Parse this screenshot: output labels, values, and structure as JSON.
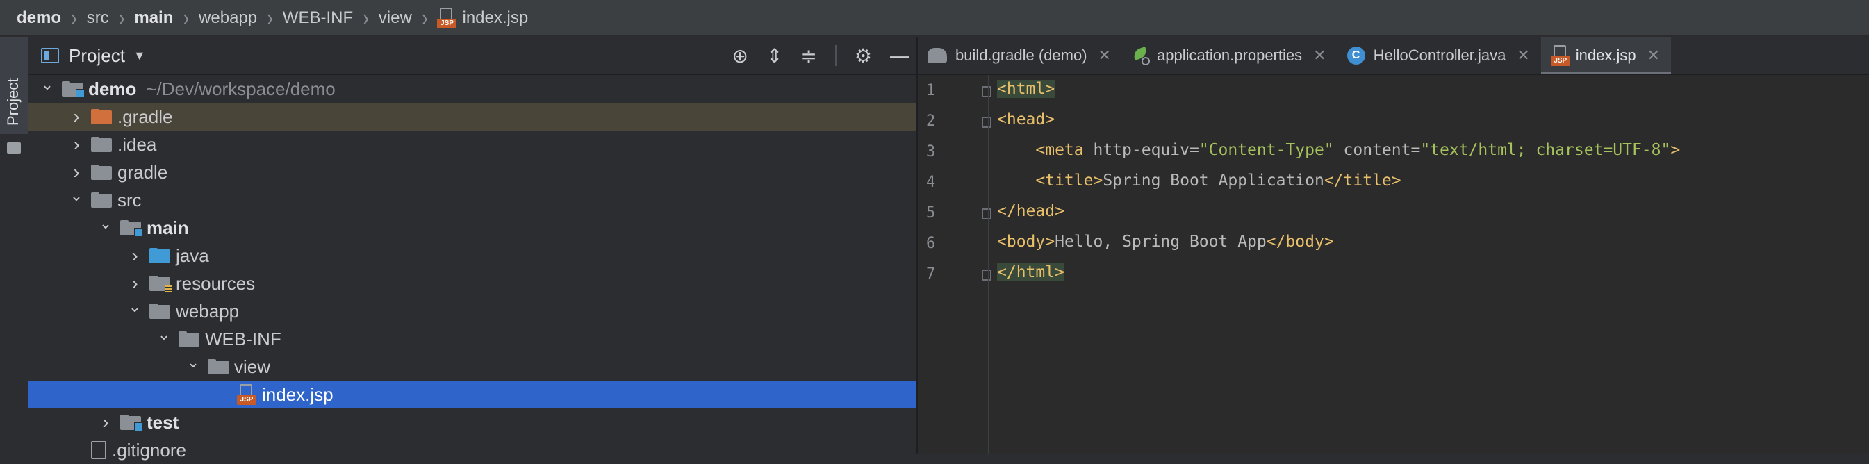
{
  "breadcrumb": [
    {
      "label": "demo",
      "bold": true
    },
    {
      "label": "src",
      "bold": false
    },
    {
      "label": "main",
      "bold": true
    },
    {
      "label": "webapp",
      "bold": false
    },
    {
      "label": "WEB-INF",
      "bold": false
    },
    {
      "label": "view",
      "bold": false
    },
    {
      "label": "index.jsp",
      "bold": false,
      "icon": "jsp-file-icon"
    }
  ],
  "tool_strip": {
    "project_label": "Project"
  },
  "project_panel": {
    "title": "Project",
    "header_icons": [
      "locate-icon",
      "expand-all-icon",
      "collapse-all-icon",
      "gear-icon",
      "minimize-icon"
    ],
    "tree": [
      {
        "name": "demo",
        "path": "~/Dev/workspace/demo",
        "level": 0,
        "expanded": true,
        "icon": "module-folder",
        "bold": true
      },
      {
        "name": ".gradle",
        "level": 1,
        "expanded": false,
        "icon": "orange-folder",
        "highlight": true
      },
      {
        "name": ".idea",
        "level": 1,
        "expanded": false,
        "icon": "folder"
      },
      {
        "name": "gradle",
        "level": 1,
        "expanded": false,
        "icon": "folder"
      },
      {
        "name": "src",
        "level": 1,
        "expanded": true,
        "icon": "folder"
      },
      {
        "name": "main",
        "level": 2,
        "expanded": true,
        "icon": "module-folder",
        "bold": true
      },
      {
        "name": "java",
        "level": 3,
        "expanded": false,
        "icon": "blue-folder"
      },
      {
        "name": "resources",
        "level": 3,
        "expanded": false,
        "icon": "resources-folder"
      },
      {
        "name": "webapp",
        "level": 3,
        "expanded": true,
        "icon": "folder"
      },
      {
        "name": "WEB-INF",
        "level": 4,
        "expanded": true,
        "icon": "folder"
      },
      {
        "name": "view",
        "level": 5,
        "expanded": true,
        "icon": "folder"
      },
      {
        "name": "index.jsp",
        "level": 6,
        "icon": "jsp-file",
        "selected": true
      },
      {
        "name": "test",
        "level": 2,
        "expanded": false,
        "icon": "module-folder",
        "bold": true
      },
      {
        "name": ".gitignore",
        "level": 1,
        "icon": "file"
      }
    ]
  },
  "tabs": [
    {
      "label": "build.gradle (demo)",
      "icon": "gradle-elephant-icon",
      "active": false
    },
    {
      "label": "application.properties",
      "icon": "spring-leaf-icon",
      "active": false
    },
    {
      "label": "HelloController.java",
      "icon": "class-icon",
      "active": false
    },
    {
      "label": "index.jsp",
      "icon": "jsp-file-icon",
      "active": true
    }
  ],
  "editor": {
    "line_numbers": [
      "1",
      "2",
      "3",
      "4",
      "5",
      "6",
      "7"
    ],
    "lines": [
      [
        {
          "t": "tg",
          "v": "<html>"
        }
      ],
      [
        {
          "t": "tg",
          "v": "<head>"
        }
      ],
      [
        {
          "t": "tx",
          "v": "    "
        },
        {
          "t": "tg",
          "v": "<meta "
        },
        {
          "t": "at",
          "v": "http-equiv="
        },
        {
          "t": "av",
          "v": "\"Content-Type\""
        },
        {
          "t": "at",
          "v": " content="
        },
        {
          "t": "av",
          "v": "\"text/html; charset=UTF-8\""
        },
        {
          "t": "tg",
          "v": ">"
        }
      ],
      [
        {
          "t": "tx",
          "v": "    "
        },
        {
          "t": "tg",
          "v": "<title>"
        },
        {
          "t": "tx",
          "v": "Spring Boot Application"
        },
        {
          "t": "tg",
          "v": "</title>"
        }
      ],
      [
        {
          "t": "tg",
          "v": "</head>"
        }
      ],
      [
        {
          "t": "tg",
          "v": "<body>"
        },
        {
          "t": "tx",
          "v": "Hello, Spring Boot App"
        },
        {
          "t": "tg",
          "v": "</body>"
        }
      ],
      [
        {
          "t": "tg",
          "v": "</html>"
        }
      ]
    ]
  },
  "colors": {
    "selection": "#2f65ca",
    "highlight_row": "#4a4539",
    "tag": "#e8bf6a",
    "attr_value": "#a5c25c"
  }
}
